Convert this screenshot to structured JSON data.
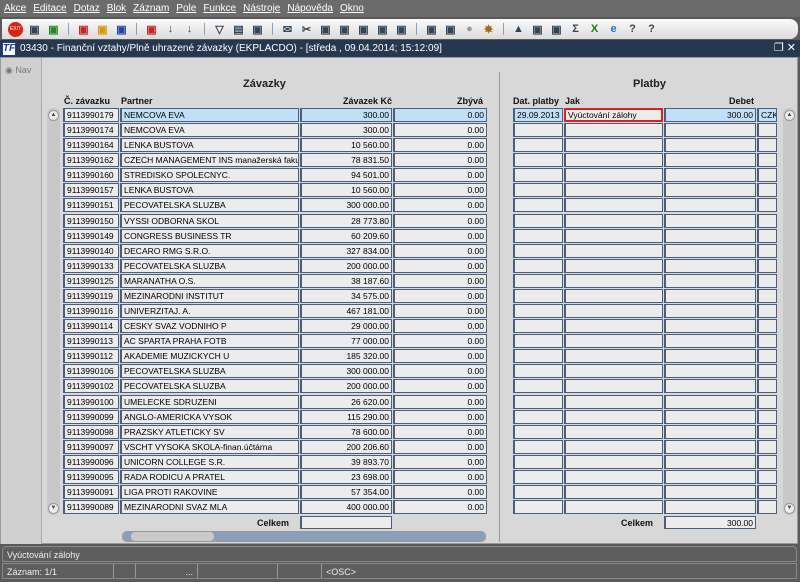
{
  "menu": [
    "Akce",
    "Editace",
    "Dotaz",
    "Blok",
    "Záznam",
    "Pole",
    "Funkce",
    "Nástroje",
    "Nápověda",
    "Okno"
  ],
  "toolbar": {
    "exit_label": "EXIT",
    "icons": [
      "insert-record-icon",
      "save-icon",
      "delete-record-icon",
      "query-icon",
      "execute-query-icon",
      "cancel-query-icon",
      "sort-asc-icon",
      "sort-desc-icon",
      "filter-icon",
      "print-icon",
      "print-setup-icon",
      "send-mail-icon",
      "cut-icon",
      "copy-icon",
      "paste-icon",
      "zoom-icon",
      "list-icon",
      "columns-icon",
      "report-icon",
      "document-icon",
      "globe-icon",
      "wheel-icon",
      "warning-icon",
      "chart-icon",
      "disk-icon",
      "sum-icon",
      "excel-icon",
      "ie-icon",
      "help-icon",
      "about-icon"
    ]
  },
  "window": {
    "title": "03430 - Finanční vztahy/Plně uhrazené závazky (EKPLACDO) - [středa , 09.04.2014; 15:12:09]",
    "logo": "TF"
  },
  "nav": {
    "label": "Nav"
  },
  "zavazky": {
    "title": "Závazky",
    "headers": [
      "Č. závazku",
      "Partner",
      "Závazek Kč",
      "Zbývá"
    ],
    "total_label": "Celkem",
    "total_value": "",
    "rows": [
      [
        "9113990179",
        "NEMCOVA EVA",
        "300.00",
        "0.00"
      ],
      [
        "9113990174",
        "NEMCOVA EVA",
        "300.00",
        "0.00"
      ],
      [
        "9113990164",
        "LENKA BUSTOVA",
        "10 560.00",
        "0.00"
      ],
      [
        "9113990162",
        "CZECH MANAGEMENT INS manažerská fakulta",
        "78 831.50",
        "0.00"
      ],
      [
        "9113990160",
        "STREDISKO SPOLECNYC.",
        "94 501.00",
        "0.00"
      ],
      [
        "9113990157",
        "LENKA BUSTOVA",
        "10 560.00",
        "0.00"
      ],
      [
        "9113990151",
        "PECOVATELSKA SLUZBA",
        "300 000.00",
        "0.00"
      ],
      [
        "9113990150",
        "VYSSI  ODBORNA  SKOL",
        "28 773.80",
        "0.00"
      ],
      [
        "9113990149",
        "CONGRESS BUSINESS TR",
        "60 209.60",
        "0.00"
      ],
      [
        "9113990140",
        "DECARO RMG S.R.O.",
        "327 834.00",
        "0.00"
      ],
      [
        "9113990133",
        "PECOVATELSKA SLUZBA",
        "200 000.00",
        "0.00"
      ],
      [
        "9113990125",
        "MARANATHA O.S.",
        "38 187.60",
        "0.00"
      ],
      [
        "9113990119",
        "MEZINARODNI INSTITUT",
        "34 575.00",
        "0.00"
      ],
      [
        "9113990116",
        "UNIVERZITAJ. A.",
        "467 181.00",
        "0.00"
      ],
      [
        "9113990114",
        "CESKY SVAZ VODNIHO P",
        "29 000.00",
        "0.00"
      ],
      [
        "9113990113",
        "AC SPARTA PRAHA FOTB",
        "77 000.00",
        "0.00"
      ],
      [
        "9113990112",
        "AKADEMIE MUZICKYCH U",
        "185 320.00",
        "0.00"
      ],
      [
        "9113990106",
        "PECOVATELSKA SLUZBA",
        "300 000.00",
        "0.00"
      ],
      [
        "9113990102",
        "PECOVATELSKA SLUZBA",
        "200 000.00",
        "0.00"
      ],
      [
        "9113990100",
        "UMELECKE SDRUZENI",
        "26 620.00",
        "0.00"
      ],
      [
        "9113990099",
        "ANGLO-AMERICKA VYSOK",
        "115 290.00",
        "0.00"
      ],
      [
        "9113990098",
        "PRAZSKY ATLETICKY SV",
        "78 600.00",
        "0.00"
      ],
      [
        "9113990097",
        "VSCHT VYSOKA SKOLA-finan.účtárna",
        "200 206.60",
        "0.00"
      ],
      [
        "9113990096",
        "UNICORN COLLEGE S.R.",
        "39 893.70",
        "0.00"
      ],
      [
        "9113990095",
        "RADA RODICU A PRATEL",
        "23 698.00",
        "0.00"
      ],
      [
        "9113990091",
        "LIGA PROTI RAKOVINE",
        "57 354.00",
        "0.00"
      ],
      [
        "9113990089",
        "MEZINARODNI SVAZ MLA",
        "400 000.00",
        "0.00"
      ]
    ]
  },
  "platby": {
    "title": "Platby",
    "headers": [
      "Dat. platby",
      "Jak",
      "Debet"
    ],
    "total_label": "Celkem",
    "total_value": "300.00",
    "rows": [
      [
        "29.09.2013",
        "Vyúctování zálohy",
        "300.00",
        "CZK"
      ]
    ],
    "empty_rows": 26
  },
  "status": {
    "message": "Vyúctování zálohy",
    "record": "Záznam: 1/1",
    "ellipsis": "...",
    "mode": "<OSC>"
  }
}
